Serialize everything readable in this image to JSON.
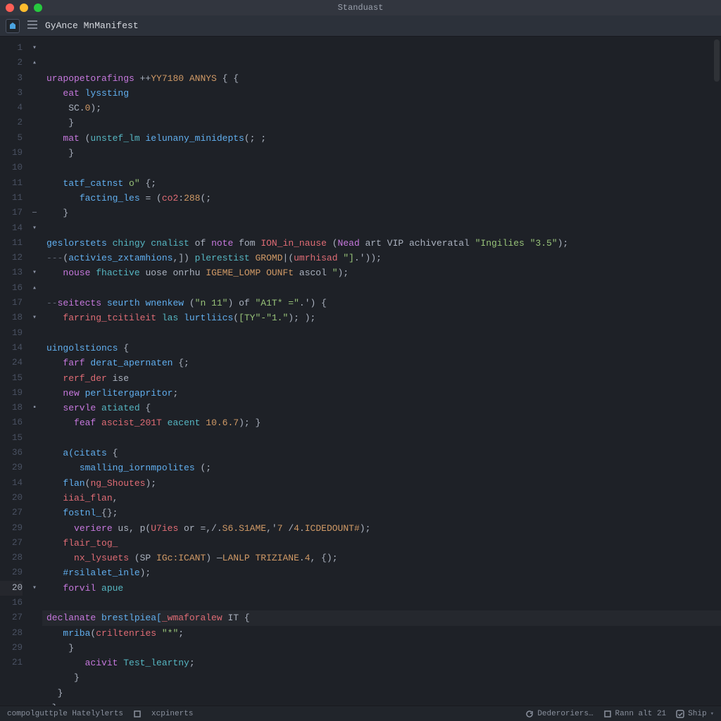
{
  "window": {
    "title": "Standuast"
  },
  "toolbar": {
    "tab": "GyAnce MnManifest"
  },
  "gutter_numbers": [
    "1",
    "2",
    "3",
    "3",
    "4",
    "2",
    "5",
    "19",
    "10",
    "11",
    "11",
    "17",
    "14",
    "11",
    "12",
    "13",
    "16",
    "17",
    "18",
    "19",
    "14",
    "24",
    "15",
    "19",
    "18",
    "16",
    "15",
    "36",
    "29",
    "14",
    "20",
    "27",
    "29",
    "27",
    "28",
    "29",
    "20",
    "16",
    "27",
    "28",
    "29",
    "21"
  ],
  "fold_marks": [
    "▾",
    "▴",
    "",
    "",
    "",
    "",
    "",
    "",
    "",
    "",
    "",
    "—",
    "▾",
    "",
    "",
    "▾",
    "▴",
    "",
    "▾",
    "",
    "",
    "",
    "",
    "",
    "▪",
    "",
    "",
    "",
    "",
    "",
    "",
    "",
    "",
    "",
    "",
    "",
    "▾",
    "",
    "",
    "",
    "",
    ""
  ],
  "current_line_index": 36,
  "code_lines": [
    [
      {
        "c": "tok-kw",
        "t": "urapopetorafings"
      },
      {
        "c": "tok-op",
        "t": " ++"
      },
      {
        "c": "tok-const",
        "t": "YY7180 ANNYS"
      },
      {
        "c": "tok-def",
        "t": " { {"
      }
    ],
    [
      {
        "c": "tok-kw",
        "t": "   eat "
      },
      {
        "c": "tok-fn",
        "t": "lyssting"
      }
    ],
    [
      {
        "c": "tok-def",
        "t": "    SC."
      },
      {
        "c": "tok-num",
        "t": "0"
      },
      {
        "c": "tok-def",
        "t": ");"
      }
    ],
    [
      {
        "c": "tok-def",
        "t": "    }"
      }
    ],
    [
      {
        "c": "tok-kw",
        "t": "   mat "
      },
      {
        "c": "tok-def",
        "t": "("
      },
      {
        "c": "tok-type",
        "t": "unstef_lm "
      },
      {
        "c": "tok-fn",
        "t": "ielunany_minidepts"
      },
      {
        "c": "tok-def",
        "t": "(; ;"
      }
    ],
    [
      {
        "c": "tok-def",
        "t": "    }"
      }
    ],
    [
      {
        "c": "tok-def",
        "t": ""
      }
    ],
    [
      {
        "c": "tok-def",
        "t": "   "
      },
      {
        "c": "tok-fn",
        "t": "tatf_catnst"
      },
      {
        "c": "tok-str",
        "t": " o\""
      },
      {
        "c": "tok-def",
        "t": " {;"
      }
    ],
    [
      {
        "c": "tok-def",
        "t": "      "
      },
      {
        "c": "tok-fn",
        "t": "facting_les"
      },
      {
        "c": "tok-def",
        "t": " = ("
      },
      {
        "c": "tok-var",
        "t": "co2"
      },
      {
        "c": "tok-def",
        "t": ":"
      },
      {
        "c": "tok-num",
        "t": "288"
      },
      {
        "c": "tok-def",
        "t": "(;"
      }
    ],
    [
      {
        "c": "tok-def",
        "t": "   }"
      }
    ],
    [
      {
        "c": "tok-def",
        "t": ""
      }
    ],
    [
      {
        "c": "tok-fn",
        "t": "geslorstets"
      },
      {
        "c": "tok-type",
        "t": " chingy cnalist"
      },
      {
        "c": "tok-def",
        "t": " of "
      },
      {
        "c": "tok-kw",
        "t": "note"
      },
      {
        "c": "tok-def",
        "t": " fom "
      },
      {
        "c": "tok-var",
        "t": "ION_in_nause"
      },
      {
        "c": "tok-def",
        "t": " ("
      },
      {
        "c": "tok-kw",
        "t": "Nead"
      },
      {
        "c": "tok-def",
        "t": " art VIP achiveratal "
      },
      {
        "c": "tok-str",
        "t": "\"Ingilies \"3.5\""
      },
      {
        "c": "tok-def",
        "t": ");"
      }
    ],
    [
      {
        "c": "tok-comment",
        "t": "---"
      },
      {
        "c": "tok-def",
        "t": "("
      },
      {
        "c": "tok-fn",
        "t": "activies_zxtamhions"
      },
      {
        "c": "tok-def",
        "t": ",]) "
      },
      {
        "c": "tok-type",
        "t": "plerestist "
      },
      {
        "c": "tok-const",
        "t": "GROMD"
      },
      {
        "c": "tok-def",
        "t": "|("
      },
      {
        "c": "tok-var",
        "t": "umrhisad "
      },
      {
        "c": "tok-str",
        "t": "\"]"
      },
      {
        "c": "tok-def",
        "t": ".'));"
      }
    ],
    [
      {
        "c": "tok-def",
        "t": "   "
      },
      {
        "c": "tok-kw",
        "t": "nouse "
      },
      {
        "c": "tok-type",
        "t": "fhactive"
      },
      {
        "c": "tok-def",
        "t": " uose onrhu "
      },
      {
        "c": "tok-const",
        "t": "IGEME_LOMP OUNFt"
      },
      {
        "c": "tok-def",
        "t": " ascol "
      },
      {
        "c": "tok-str",
        "t": "\""
      },
      {
        "c": "tok-def",
        "t": ");"
      }
    ],
    [
      {
        "c": "tok-def",
        "t": ""
      }
    ],
    [
      {
        "c": "tok-comment",
        "t": "--"
      },
      {
        "c": "tok-kw",
        "t": "seitects"
      },
      {
        "c": "tok-fn",
        "t": " seurth wnenkew"
      },
      {
        "c": "tok-def",
        "t": " ("
      },
      {
        "c": "tok-str",
        "t": "\"n 11\""
      },
      {
        "c": "tok-def",
        "t": ") of "
      },
      {
        "c": "tok-str",
        "t": "\"A1T* =\""
      },
      {
        "c": "tok-def",
        "t": ".') {"
      }
    ],
    [
      {
        "c": "tok-def",
        "t": "   "
      },
      {
        "c": "tok-var",
        "t": "farring_tcitileit"
      },
      {
        "c": "tok-type",
        "t": " las "
      },
      {
        "c": "tok-fn",
        "t": "lurtliics"
      },
      {
        "c": "tok-def",
        "t": "("
      },
      {
        "c": "tok-str",
        "t": "[TY\"-\"1.\""
      },
      {
        "c": "tok-def",
        "t": "); );"
      }
    ],
    [
      {
        "c": "tok-def",
        "t": ""
      }
    ],
    [
      {
        "c": "tok-fn",
        "t": "uingolstioncs"
      },
      {
        "c": "tok-def",
        "t": " {"
      }
    ],
    [
      {
        "c": "tok-def",
        "t": "   "
      },
      {
        "c": "tok-kw",
        "t": "farf "
      },
      {
        "c": "tok-fn",
        "t": "derat_apernaten"
      },
      {
        "c": "tok-def",
        "t": " {;"
      }
    ],
    [
      {
        "c": "tok-def",
        "t": "   "
      },
      {
        "c": "tok-var",
        "t": "rerf_der"
      },
      {
        "c": "tok-def",
        "t": " ise"
      }
    ],
    [
      {
        "c": "tok-def",
        "t": "   "
      },
      {
        "c": "tok-kw",
        "t": "new "
      },
      {
        "c": "tok-fn",
        "t": "perlitergapritor"
      },
      {
        "c": "tok-def",
        "t": ";"
      }
    ],
    [
      {
        "c": "tok-def",
        "t": "   "
      },
      {
        "c": "tok-kw",
        "t": "servle "
      },
      {
        "c": "tok-type",
        "t": "atiated"
      },
      {
        "c": "tok-def",
        "t": " {"
      }
    ],
    [
      {
        "c": "tok-def",
        "t": "     "
      },
      {
        "c": "tok-kw",
        "t": "feaf "
      },
      {
        "c": "tok-var",
        "t": "ascist_201T"
      },
      {
        "c": "tok-type",
        "t": " eacent "
      },
      {
        "c": "tok-num",
        "t": "10.6.7"
      },
      {
        "c": "tok-def",
        "t": "); }"
      }
    ],
    [
      {
        "c": "tok-def",
        "t": ""
      }
    ],
    [
      {
        "c": "tok-def",
        "t": "   "
      },
      {
        "c": "tok-fn",
        "t": "a(citats"
      },
      {
        "c": "tok-def",
        "t": " {"
      }
    ],
    [
      {
        "c": "tok-def",
        "t": "      "
      },
      {
        "c": "tok-fn",
        "t": "smalling_iornmpolites"
      },
      {
        "c": "tok-def",
        "t": " (;"
      }
    ],
    [
      {
        "c": "tok-def",
        "t": "   "
      },
      {
        "c": "tok-fn",
        "t": "flan"
      },
      {
        "c": "tok-def",
        "t": "("
      },
      {
        "c": "tok-var",
        "t": "ng_Shoutes"
      },
      {
        "c": "tok-def",
        "t": ");"
      }
    ],
    [
      {
        "c": "tok-def",
        "t": "   "
      },
      {
        "c": "tok-var",
        "t": "iiai_flan"
      },
      {
        "c": "tok-def",
        "t": ","
      }
    ],
    [
      {
        "c": "tok-def",
        "t": "   "
      },
      {
        "c": "tok-fn",
        "t": "fostnl_"
      },
      {
        "c": "tok-def",
        "t": "{};"
      }
    ],
    [
      {
        "c": "tok-def",
        "t": "     "
      },
      {
        "c": "tok-kw",
        "t": "veriere"
      },
      {
        "c": "tok-def",
        "t": " us, p("
      },
      {
        "c": "tok-var",
        "t": "U7ies"
      },
      {
        "c": "tok-def",
        "t": " or =,/."
      },
      {
        "c": "tok-const",
        "t": "S6.S1AME"
      },
      {
        "c": "tok-def",
        "t": ",'"
      },
      {
        "c": "tok-num",
        "t": "7"
      },
      {
        "c": "tok-def",
        "t": " /"
      },
      {
        "c": "tok-num",
        "t": "4"
      },
      {
        "c": "tok-def",
        "t": "."
      },
      {
        "c": "tok-const",
        "t": "ICDEDOUNT#"
      },
      {
        "c": "tok-def",
        "t": ");"
      }
    ],
    [
      {
        "c": "tok-def",
        "t": "   "
      },
      {
        "c": "tok-var",
        "t": "flair_tog_"
      }
    ],
    [
      {
        "c": "tok-def",
        "t": "     "
      },
      {
        "c": "tok-var",
        "t": "nx_lysuets"
      },
      {
        "c": "tok-def",
        "t": " (SP "
      },
      {
        "c": "tok-const",
        "t": "IGc:ICANT"
      },
      {
        "c": "tok-def",
        "t": ") —"
      },
      {
        "c": "tok-const",
        "t": "LANLP TRIZIANE"
      },
      {
        "c": "tok-def",
        "t": "."
      },
      {
        "c": "tok-num",
        "t": "4"
      },
      {
        "c": "tok-def",
        "t": ", {);"
      }
    ],
    [
      {
        "c": "tok-def",
        "t": "   "
      },
      {
        "c": "tok-fn",
        "t": "#rsilalet_inle"
      },
      {
        "c": "tok-def",
        "t": ");"
      }
    ],
    [
      {
        "c": "tok-def",
        "t": "   "
      },
      {
        "c": "tok-kw",
        "t": "forvil "
      },
      {
        "c": "tok-type",
        "t": "apue"
      }
    ],
    [
      {
        "c": "tok-def",
        "t": ""
      }
    ],
    [
      {
        "c": "tok-kw",
        "t": "declanate "
      },
      {
        "c": "tok-fn",
        "t": "brestlpiea["
      },
      {
        "c": "tok-var",
        "t": "_wmaforalew"
      },
      {
        "c": "tok-def",
        "t": " IT {"
      }
    ],
    [
      {
        "c": "tok-def",
        "t": "   "
      },
      {
        "c": "tok-fn",
        "t": "mriba"
      },
      {
        "c": "tok-def",
        "t": "("
      },
      {
        "c": "tok-var",
        "t": "criltenries "
      },
      {
        "c": "tok-str",
        "t": "\"*\""
      },
      {
        "c": "tok-def",
        "t": ";"
      }
    ],
    [
      {
        "c": "tok-def",
        "t": "    }"
      }
    ],
    [
      {
        "c": "tok-def",
        "t": "       "
      },
      {
        "c": "tok-kw",
        "t": "acivit "
      },
      {
        "c": "tok-type",
        "t": "Test_leartny"
      },
      {
        "c": "tok-def",
        "t": ";"
      }
    ],
    [
      {
        "c": "tok-def",
        "t": "     }"
      }
    ],
    [
      {
        "c": "tok-def",
        "t": "  }"
      }
    ],
    [
      {
        "c": "tok-def",
        "t": " };"
      }
    ]
  ],
  "statusbar": {
    "left1": "compolguttple Hatelylerts",
    "left2": "xcpinerts",
    "right1": "Dederoriers…",
    "right2": "Rann alt 21",
    "right3": "Ship"
  }
}
